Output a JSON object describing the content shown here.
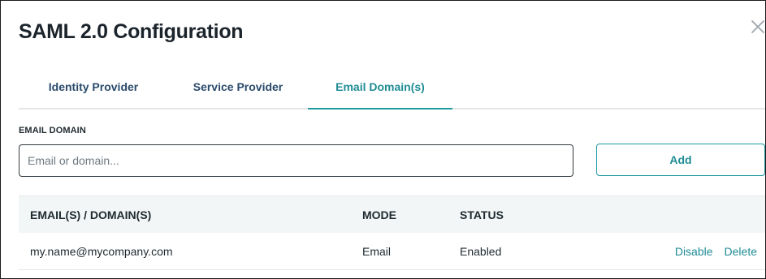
{
  "dialog": {
    "title": "SAML 2.0 Configuration",
    "close_icon": "close-icon"
  },
  "tabs": [
    {
      "label": "Identity Provider",
      "active": false
    },
    {
      "label": "Service Provider",
      "active": false
    },
    {
      "label": "Email Domain(s)",
      "active": true
    }
  ],
  "form": {
    "label": "EMAIL DOMAIN",
    "placeholder": "Email or domain...",
    "value": "",
    "add_label": "Add"
  },
  "table": {
    "headers": {
      "domain": "EMAIL(S) / DOMAIN(S)",
      "mode": "MODE",
      "status": "STATUS"
    },
    "rows": [
      {
        "domain": "my.name@mycompany.com",
        "mode": "Email",
        "status": "Enabled",
        "disable_label": "Disable",
        "delete_label": "Delete"
      }
    ]
  },
  "colors": {
    "accent": "#1f9aa3",
    "tab_text": "#2a4a6b",
    "header_bg": "#f2f6f7"
  }
}
